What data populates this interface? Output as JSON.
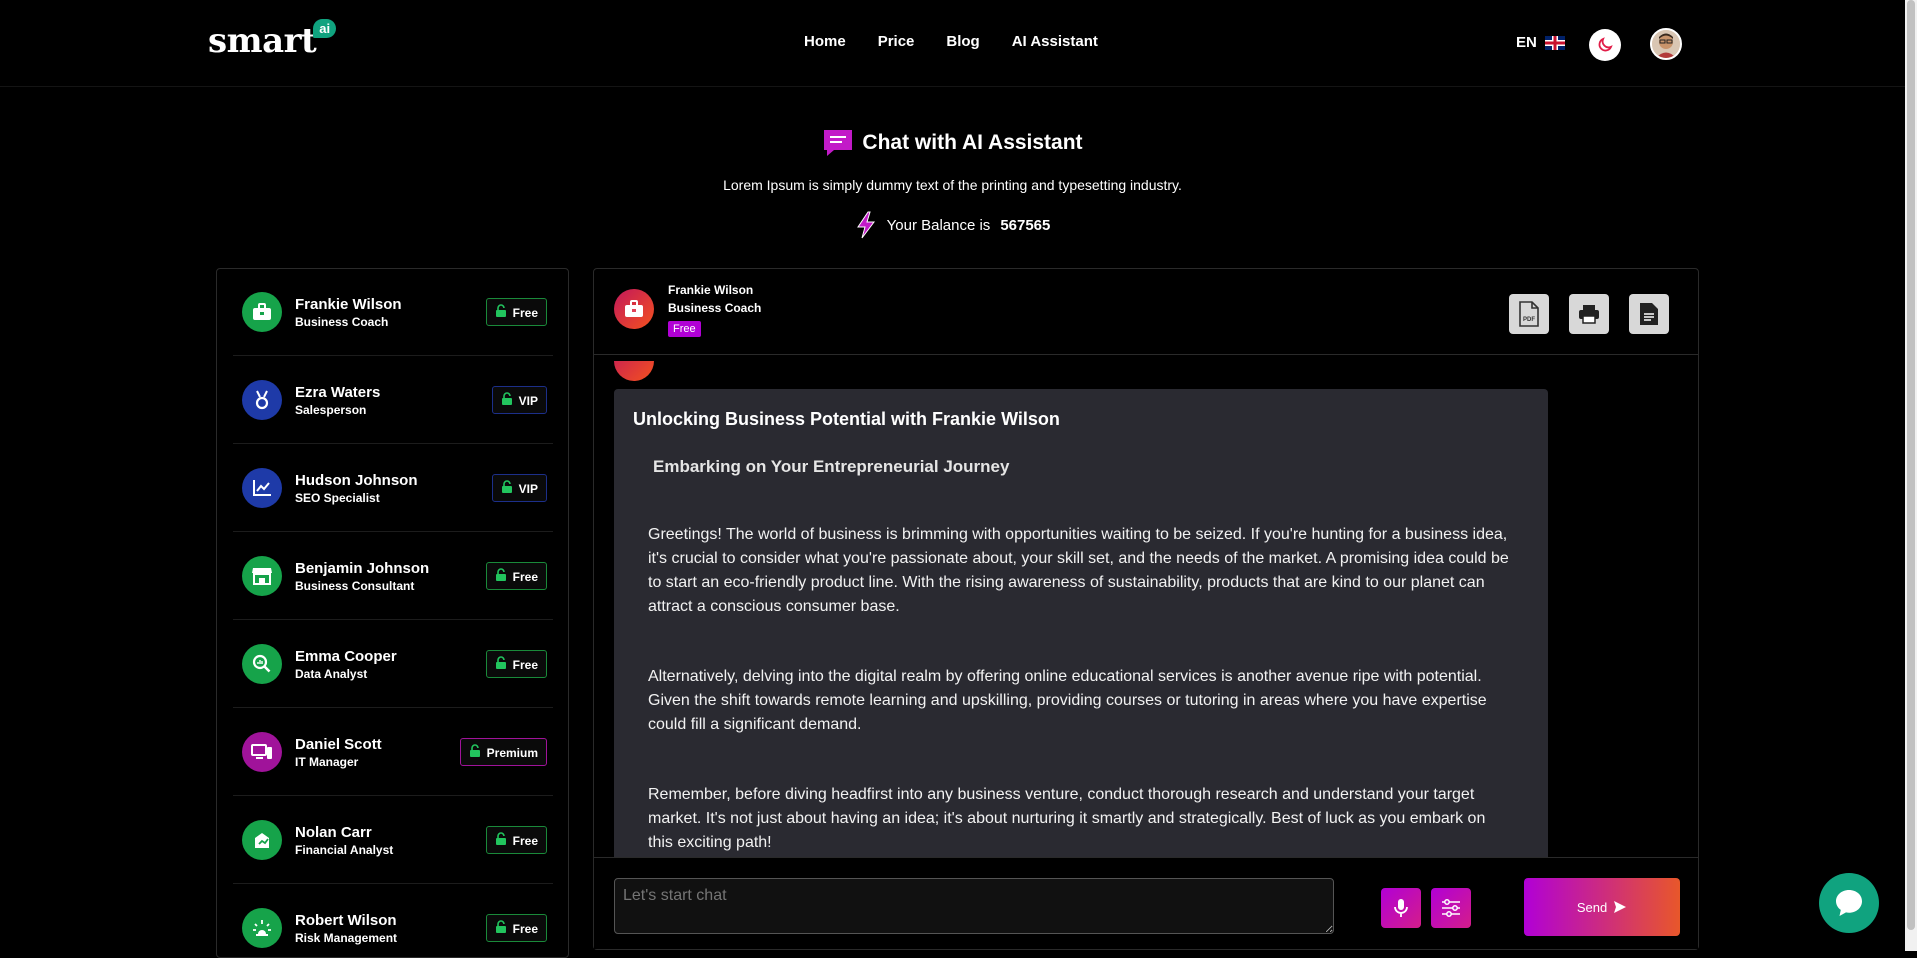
{
  "header": {
    "logo_text": "smart",
    "logo_badge": "ai",
    "nav": [
      "Home",
      "Price",
      "Blog",
      "AI Assistant"
    ],
    "language": "EN"
  },
  "hero": {
    "title": "Chat with AI Assistant",
    "subtitle": "Lorem Ipsum is simply dummy text of the printing and typesetting industry.",
    "balance_label": "Your Balance is",
    "balance_value": "567565"
  },
  "agents": [
    {
      "name": "Frankie Wilson",
      "role": "Business Coach",
      "tier": "Free",
      "icon": "briefcase-icon",
      "color": "#16a34a"
    },
    {
      "name": "Ezra Waters",
      "role": "Salesperson",
      "tier": "VIP",
      "icon": "medal-icon",
      "color": "#1e3aa8"
    },
    {
      "name": "Hudson Johnson",
      "role": "SEO Specialist",
      "tier": "VIP",
      "icon": "chart-line-icon",
      "color": "#1e3aa8"
    },
    {
      "name": "Benjamin Johnson",
      "role": "Business Consultant",
      "tier": "Free",
      "icon": "store-icon",
      "color": "#16a34a"
    },
    {
      "name": "Emma Cooper",
      "role": "Data Analyst",
      "tier": "Free",
      "icon": "search-data-icon",
      "color": "#16a34a"
    },
    {
      "name": "Daniel Scott",
      "role": "IT Manager",
      "tier": "Premium",
      "icon": "computer-icon",
      "color": "#a0139a"
    },
    {
      "name": "Nolan Carr",
      "role": "Financial Analyst",
      "tier": "Free",
      "icon": "finance-icon",
      "color": "#16a34a"
    },
    {
      "name": "Robert Wilson",
      "role": "Risk Management",
      "tier": "Free",
      "icon": "alert-icon",
      "color": "#16a34a"
    }
  ],
  "chat": {
    "agent_name": "Frankie Wilson",
    "agent_role": "Business Coach",
    "agent_tier": "Free",
    "message_title": "Unlocking Business Potential with Frankie Wilson",
    "message_subtitle": "Embarking on Your Entrepreneurial Journey",
    "paragraphs": [
      "Greetings! The world of business is brimming with opportunities waiting to be seized. If you're hunting for a business idea, it's crucial to consider what you're passionate about, your skill set, and the needs of the market. A promising idea could be to start an eco-friendly product line. With the rising awareness of sustainability, products that are kind to our planet can attract a conscious consumer base.",
      "Alternatively, delving into the digital realm by offering online educational services is another avenue ripe with potential. Given the shift towards remote learning and upskilling, providing courses or tutoring in areas where you have expertise could fill a significant demand.",
      "Remember, before diving headfirst into any business venture, conduct thorough research and understand your target market. It's not just about having an idea; it's about nurturing it smartly and strategically. Best of luck as you embark on this exciting path!"
    ],
    "input_placeholder": "Let's start chat",
    "send_label": "Send"
  }
}
